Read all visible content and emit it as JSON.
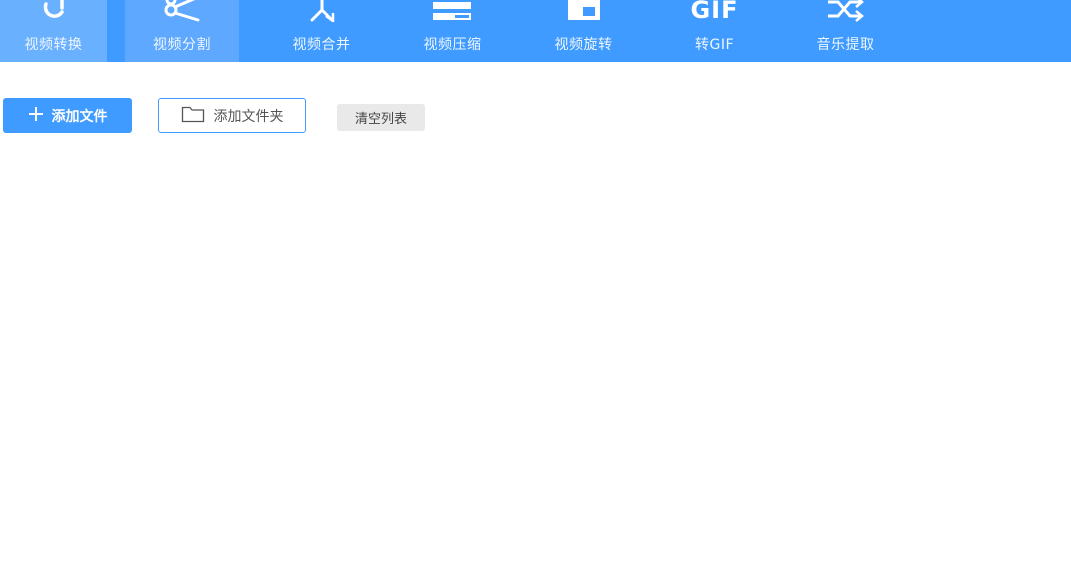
{
  "colors": {
    "toolbar_bg": "#3f9bff",
    "active_tab_bg": "#69b0ff",
    "primary": "#3f9bff",
    "gray_button": "#e9e9ea"
  },
  "toolbar": {
    "items": [
      {
        "label": "视频转换",
        "icon": "refresh-icon"
      },
      {
        "label": "视频分割",
        "icon": "scissors-icon"
      },
      {
        "label": "视频合并",
        "icon": "merge-icon"
      },
      {
        "label": "视频压缩",
        "icon": "compress-icon"
      },
      {
        "label": "视频旋转",
        "icon": "rotate-icon"
      },
      {
        "label": "转GIF",
        "icon": "gif-icon",
        "icon_text": "GIF"
      },
      {
        "label": "音乐提取",
        "icon": "shuffle-icon"
      }
    ]
  },
  "actions": {
    "add_file": "添加文件",
    "add_folder": "添加文件夹",
    "clear_list": "清空列表"
  }
}
